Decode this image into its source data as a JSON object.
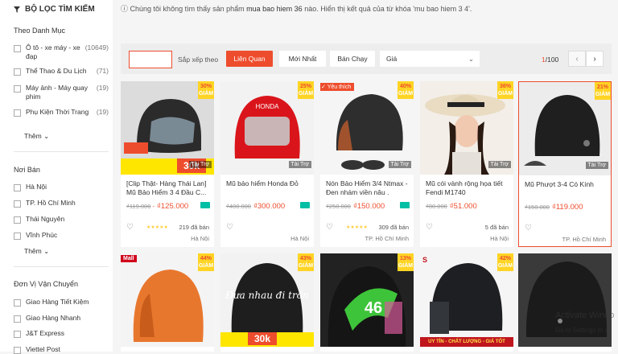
{
  "filters": {
    "title": "BỘ LỌC TÌM KIẾM",
    "category": {
      "heading": "Theo Danh Mục",
      "items": [
        {
          "label": "Ô tô - xe máy - xe đạp",
          "count": "(10649)"
        },
        {
          "label": "Thể Thao & Du Lịch",
          "count": "(71)"
        },
        {
          "label": "Máy ảnh - Máy quay phim",
          "count": "(19)"
        },
        {
          "label": "Phụ Kiện Thời Trang",
          "count": "(19)"
        }
      ],
      "more": "Thêm"
    },
    "location": {
      "heading": "Nơi Bán",
      "items": [
        "Hà Nội",
        "TP. Hồ Chí Minh",
        "Thái Nguyên",
        "Vĩnh Phúc"
      ],
      "more": "Thêm"
    },
    "shipping": {
      "heading": "Đơn Vị Vận Chuyển",
      "items": [
        "Giao Hàng Tiết Kiệm",
        "Giao Hàng Nhanh",
        "J&T Express",
        "Viettel Post"
      ]
    }
  },
  "notice": {
    "prefix": "Chúng tôi không tìm thấy sản phẩm",
    "query": "mua bao hiem 36",
    "middle": "nào. Hiển thị kết quả của từ khóa",
    "alt": "'mu bao hiem 3 4'."
  },
  "sortbar": {
    "label": "Sắp xếp theo",
    "buttons": [
      "Liên Quan",
      "Mới Nhất",
      "Bán Chạy"
    ],
    "price_select": "Giá",
    "page_current": "1",
    "page_total": "/100",
    "prev": "‹",
    "next": "›"
  },
  "products": [
    {
      "name": "[Clip Thật- Hàng Thái Lan] Mũ Bảo Hiểm 3 4 Đầu C...",
      "old_price": "₫119.000",
      "new_price": "₫125.000",
      "discount": "30%",
      "discount_word": "GIẢM",
      "tag": "Tài Trợ",
      "stars": "★★★★★",
      "sold": "219 đã bán",
      "location": "Hà Nội",
      "banner_price": "30k"
    },
    {
      "name": "Mũ bảo hiểm Honda Đỏ",
      "old_price": "₫400.000",
      "new_price": "₫300.000",
      "discount": "25%",
      "discount_word": "GIẢM",
      "tag": "Tài Trợ",
      "location": "Hà Nội",
      "helmet_brand": "HONDA"
    },
    {
      "name": "Nón Bảo Hiểm 3/4 Ntmax - Đen nhám viền nâu .",
      "old_price": "₫250.000",
      "new_price": "₫150.000",
      "discount": "40%",
      "discount_word": "GIẢM",
      "tag": "Tài Trợ",
      "favorite": "Yêu thích",
      "stars": "★★★★★",
      "sold": "309 đã bán",
      "location": "TP. Hồ Chí Minh"
    },
    {
      "name": "Mũ cói vành rộng họa tiết Fendi M1740",
      "old_price": "₫80.000",
      "new_price": "₫51.000",
      "discount": "36%",
      "discount_word": "GIẢM",
      "tag": "Tài Trợ",
      "sold": "5 đã bán",
      "location": "Hà Nội"
    },
    {
      "name": "Mũ Phượt 3-4 Có Kính",
      "old_price": "₫150.000",
      "new_price": "₫119.000",
      "discount": "21%",
      "discount_word": "GIẢM",
      "tag": "Tài Trợ",
      "location": "TP. Hồ Chí Minh"
    },
    {
      "mall": "Mall",
      "discount": "44%",
      "discount_word": "GIẢM"
    },
    {
      "discount": "43%",
      "discount_word": "GIẢM",
      "banner_price": "30k",
      "helmet_text": "Đưa nhau đi trốn"
    },
    {
      "discount": "13%",
      "discount_word": "GIẢM",
      "helmet_number": "46"
    },
    {
      "discount": "42%",
      "discount_word": "GIẢM",
      "banner_text": "UY TÍN - CHẤT LƯỢNG - GIÁ TỐT"
    },
    {}
  ],
  "watermark": {
    "line1": "Activate Windo",
    "line2": "Go to Settings to a"
  },
  "colors": {
    "accent": "#ee4d2d",
    "badge": "#ffd424",
    "shipping_icon": "#00bfa5"
  }
}
